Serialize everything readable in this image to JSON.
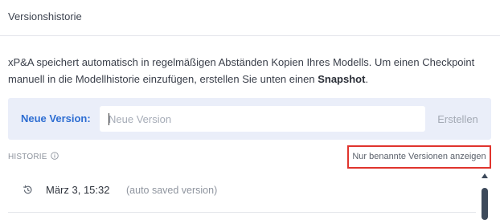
{
  "panel": {
    "title": "Versionshistorie"
  },
  "description": {
    "text": "xP&A speichert automatisch in regelmäßigen Abständen Kopien Ihres Modells. Um einen Checkpoint manuell in die Modellhistorie einzufügen, erstellen Sie unten einen ",
    "bold": "Snapshot",
    "suffix": "."
  },
  "new_version": {
    "label": "Neue Version:",
    "input_value": "",
    "placeholder": "Neue Version",
    "create_label": "Erstellen"
  },
  "history": {
    "label": "HISTORIE",
    "info_icon": "info-icon",
    "show_named_label": "Nur benannte Versionen anzeigen",
    "entries": [
      {
        "icon": "history-icon",
        "time": "März 3, 15:32",
        "note": "(auto saved version)"
      }
    ]
  },
  "colors": {
    "accent": "#2d6dd2",
    "new_version_bg": "#eaeef9",
    "highlight_border": "#e0342d",
    "scrollbar": "#3d4a5b"
  }
}
